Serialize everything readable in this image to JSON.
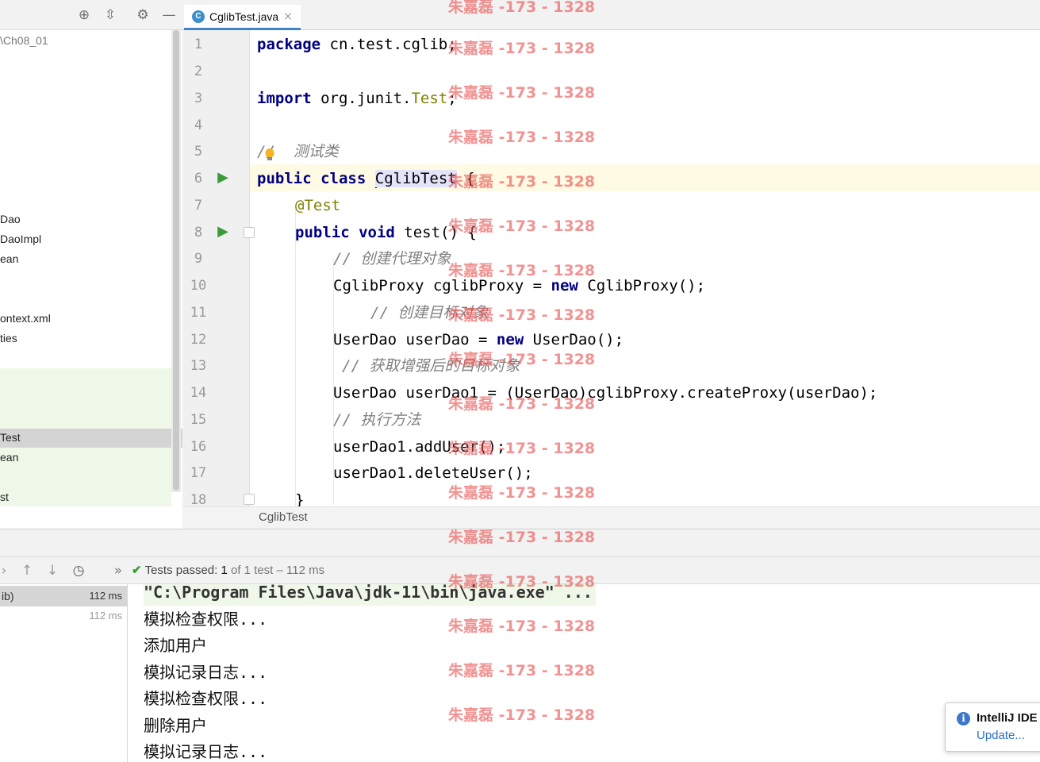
{
  "project_panel": {
    "tree_items": [
      "\\Ch08_01",
      "Dao",
      "DaoImpl",
      "ean",
      "ontext.xml",
      "ties",
      "Test",
      "ean",
      "st"
    ]
  },
  "editor": {
    "tab": {
      "label": "CglibTest.java",
      "icon": "java-class-icon"
    },
    "line_numbers": [
      "1",
      "2",
      "3",
      "4",
      "5",
      "6",
      "7",
      "8",
      "9",
      "10",
      "11",
      "12",
      "13",
      "14",
      "15",
      "16",
      "17",
      "18"
    ],
    "code": {
      "l1_kw": "package",
      "l1_rest": " cn.test.cglib;",
      "l3_kw": "import",
      "l3_rest1": " org.junit.",
      "l3_ann": "Test",
      "l3_rest2": ";",
      "l5": "//  测试类",
      "l6_kw1": "public",
      "l6_kw2": "class",
      "l6_name": "CglibTest",
      "l6_brace": " {",
      "l7": "@Test",
      "l8_kw1": "public",
      "l8_kw2": "void",
      "l8_rest": " test() {",
      "l9": "// 创建代理对象",
      "l10_a": "CglibProxy cglibProxy = ",
      "l10_kw": "new",
      "l10_b": " CglibProxy();",
      "l11": "// 创建目标对象",
      "l12_a": "UserDao userDao = ",
      "l12_kw": "new",
      "l12_b": " UserDao();",
      "l13": "// 获取增强后的目标对象",
      "l14": "UserDao userDao1 = (UserDao)cglibProxy.createProxy(userDao);",
      "l15": "// 执行方法",
      "l16": "userDao1.addUser();",
      "l17": "userDao1.deleteUser();",
      "l18": "}"
    },
    "breadcrumb": "CglibTest"
  },
  "run_panel": {
    "status": {
      "label": "Tests passed:",
      "count": "1",
      "of_text": "of 1 test – 112 ms"
    },
    "test_tree": [
      {
        "name": "ib)",
        "time": "112 ms"
      },
      {
        "name": "",
        "time": "112 ms"
      }
    ],
    "console": [
      "\"C:\\Program Files\\Java\\jdk-11\\bin\\java.exe\" ...",
      "模拟检查权限...",
      "添加用户",
      "模拟记录日志...",
      "模拟检查权限...",
      "删除用户",
      "模拟记录日志..."
    ]
  },
  "notification": {
    "title": "IntelliJ IDE",
    "link": "Update..."
  },
  "watermark": "朱嘉磊 -173 - 1328",
  "colors": {
    "keyword": "#000080",
    "annotation": "#808000",
    "comment": "#808080",
    "pass": "#3a9a3a",
    "watermark": "#e85050"
  }
}
